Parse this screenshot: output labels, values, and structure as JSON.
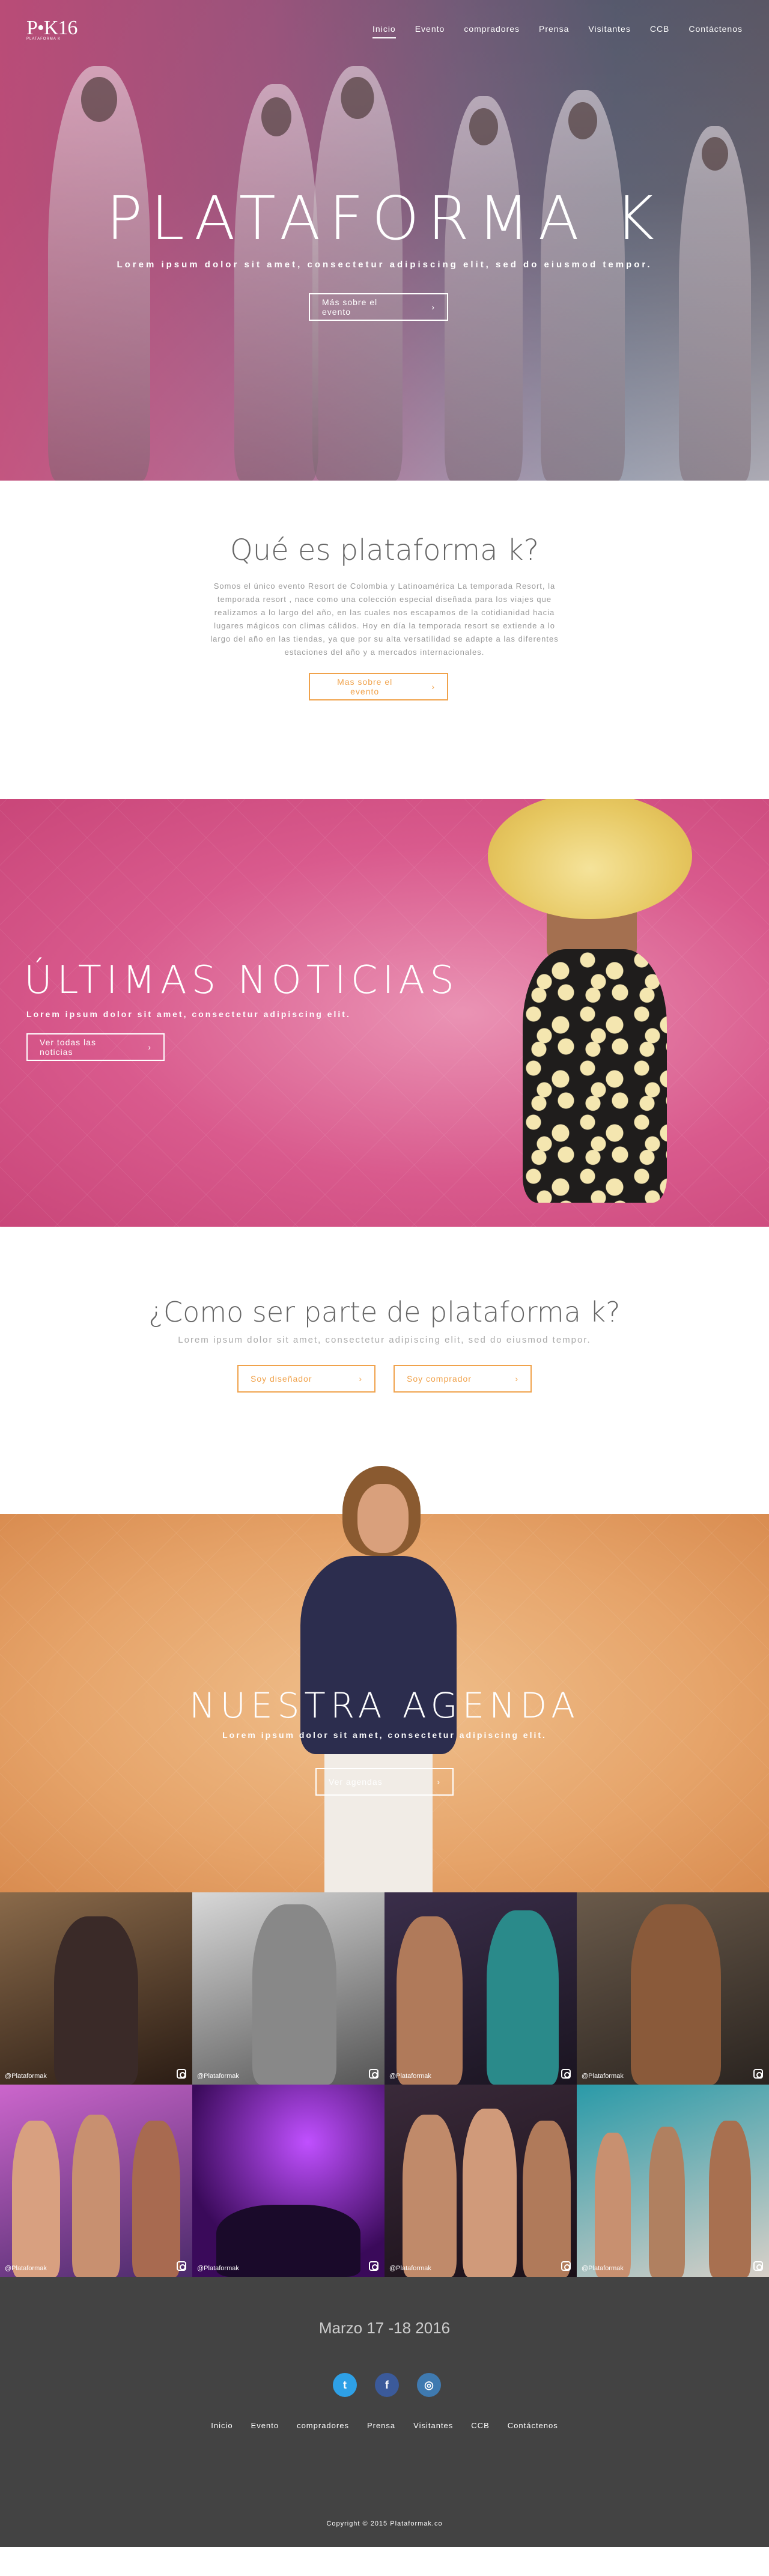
{
  "brand": {
    "logo_text": "P•K16",
    "logo_tagline": "PLATAFORMA K"
  },
  "nav": {
    "items": [
      {
        "label": "Inicio",
        "active": true
      },
      {
        "label": "Evento"
      },
      {
        "label": "compradores"
      },
      {
        "label": "Prensa"
      },
      {
        "label": "Visitantes"
      },
      {
        "label": "CCB"
      },
      {
        "label": "Contáctenos"
      }
    ]
  },
  "hero": {
    "title": "PLATAFORMA K",
    "subtitle": "Lorem ipsum dolor sit amet, consectetur adipiscing elit, sed do eiusmod tempor.",
    "button_label": "Más sobre el evento"
  },
  "about": {
    "title": "Qué es plataforma k?",
    "body": "Somos el único evento Resort de Colombia y Latinoamérica La temporada Resort, la temporada resort , nace como una colección especial diseñada para los viajes que realizamos a lo largo del año, en las cuales nos escapamos de la cotidianidad hacia lugares mágicos con climas cálidos. Hoy en día la temporada resort se extiende a lo largo del año en las tiendas, ya que por su alta versatilidad se adapte a las diferentes estaciones del año y a mercados internacionales.",
    "button_label": "Mas sobre el evento"
  },
  "news": {
    "title": "ÚLTIMAS NOTICIAS",
    "subtitle": "Lorem ipsum dolor sit amet, consectetur adipiscing elit.",
    "button_label": "Ver todas las noticias"
  },
  "join": {
    "title": "¿Como ser parte de plataforma k?",
    "subtitle": "Lorem ipsum dolor sit amet, consectetur adipiscing elit, sed do eiusmod tempor.",
    "designer_label": "Soy diseñador",
    "buyer_label": "Soy comprador"
  },
  "agenda": {
    "title": "NUESTRA AGENDA",
    "subtitle": "Lorem ipsum dolor sit amet, consectetur adipiscing elit.",
    "button_label": "Ver agendas"
  },
  "gallery": {
    "handle": "@Plataformak"
  },
  "footer": {
    "date": "Marzo 17 -18 2016",
    "twitter": "t",
    "facebook": "f",
    "instagram": "◎",
    "nav": [
      "Inicio",
      "Evento",
      "compradores",
      "Prensa",
      "Visitantes",
      "CCB",
      "Contáctenos"
    ],
    "copyright": "Copyright © 2015 Plataformak.co"
  },
  "colors": {
    "accent": "#f0a24b",
    "pink": "#d95a8d",
    "orange": "#e6a46a",
    "footer": "#434343"
  }
}
